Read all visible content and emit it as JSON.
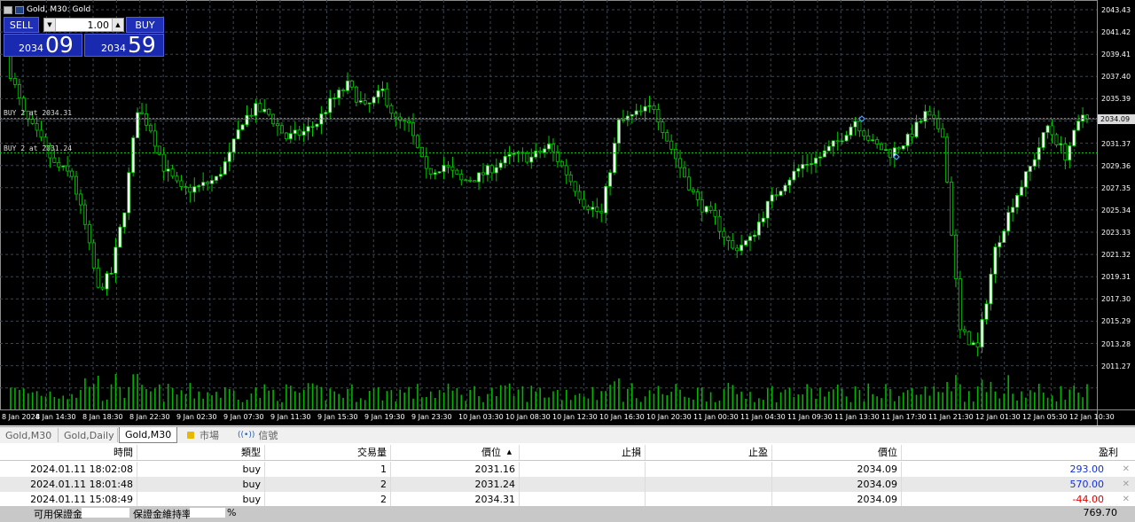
{
  "chart": {
    "title": "Gold, M30: Gold",
    "sell_label": "SELL",
    "buy_label": "BUY",
    "lot_value": "1.00",
    "sell_price_prefix": "2034",
    "sell_price_big": "09",
    "buy_price_prefix": "2034",
    "buy_price_big": "59",
    "trade_line_1": "BUY 2 at 2034.31",
    "trade_line_2": "BUY 2 at 2031.24",
    "current_price": "2034.09",
    "price_axis": [
      "2043.43",
      "2041.42",
      "2039.41",
      "2037.40",
      "2035.39",
      "2033.38",
      "2031.37",
      "2029.36",
      "2027.35",
      "2025.34",
      "2023.33",
      "2021.32",
      "2019.31",
      "2017.30",
      "2015.29",
      "2013.28",
      "2011.27"
    ],
    "time_axis": [
      "8 Jan 2024",
      "8 Jan 14:30",
      "8 Jan 18:30",
      "8 Jan 22:30",
      "9 Jan 02:30",
      "9 Jan 07:30",
      "9 Jan 11:30",
      "9 Jan 15:30",
      "9 Jan 19:30",
      "9 Jan 23:30",
      "10 Jan 03:30",
      "10 Jan 08:30",
      "10 Jan 12:30",
      "10 Jan 16:30",
      "10 Jan 20:30",
      "11 Jan 00:30",
      "11 Jan 04:30",
      "11 Jan 09:30",
      "11 Jan 13:30",
      "11 Jan 17:30",
      "11 Jan 21:30",
      "12 Jan 01:30",
      "12 Jan 05:30",
      "12 Jan 10:30"
    ],
    "colors": {
      "bull": "#ffffff",
      "bear": "#000000",
      "wick": "#00c800",
      "grid": "#3c4650",
      "volume": "#00b400"
    }
  },
  "tabs": {
    "items": [
      "Gold,M30",
      "Gold,Daily",
      "Gold,M30"
    ],
    "market": "市場",
    "signals": "信號"
  },
  "table": {
    "headers": {
      "time": "時間",
      "type": "類型",
      "volume": "交易量",
      "price": "價位",
      "sl": "止損",
      "tp": "止盈",
      "cur_price": "價位",
      "profit": "盈利"
    },
    "rows": [
      {
        "time": "2024.01.11 18:02:08",
        "type": "buy",
        "volume": "1",
        "price": "2031.16",
        "sl": "",
        "tp": "",
        "cur_price": "2034.09",
        "profit": "293.00"
      },
      {
        "time": "2024.01.11 18:01:48",
        "type": "buy",
        "volume": "2",
        "price": "2031.24",
        "sl": "",
        "tp": "",
        "cur_price": "2034.09",
        "profit": "570.00"
      },
      {
        "time": "2024.01.11 15:08:49",
        "type": "buy",
        "volume": "2",
        "price": "2034.31",
        "sl": "",
        "tp": "",
        "cur_price": "2034.09",
        "profit": "-44.00"
      }
    ],
    "footer_free_margin": "可用保證金:",
    "footer_margin_level": "保證金維持率:",
    "footer_pct": "%",
    "footer_total": "769.70"
  }
}
